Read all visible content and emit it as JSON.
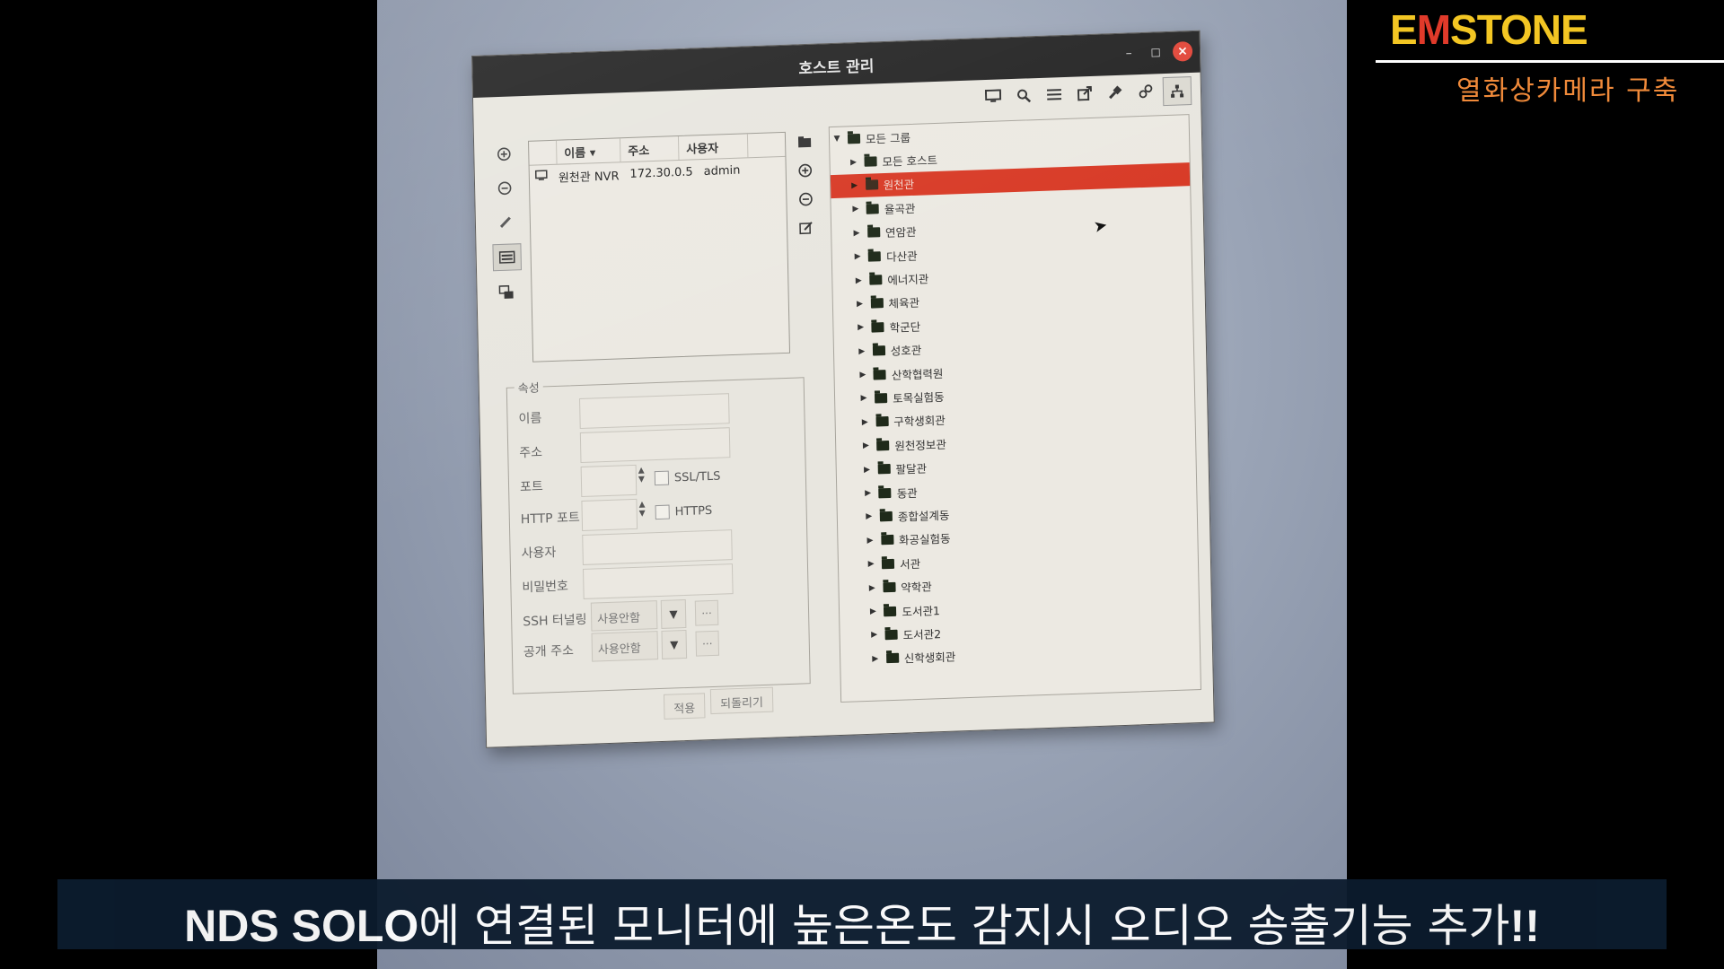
{
  "window": {
    "title": "호스트 관리",
    "min": "–",
    "max": "◻",
    "close": "×"
  },
  "toolbar_icons": [
    "monitor-icon",
    "search-icon",
    "list-icon",
    "external-link-icon",
    "plugin-icon",
    "unplug-icon",
    "hierarchy-icon"
  ],
  "host_table": {
    "columns": [
      "이름 ▾",
      "주소",
      "사용자"
    ],
    "rows": [
      {
        "name": "원천관 NVR",
        "address": "172.30.0.5",
        "user": "admin"
      }
    ]
  },
  "properties": {
    "legend": "속성",
    "name_label": "이름",
    "address_label": "주소",
    "port_label": "포트",
    "http_port_label": "HTTP 포트",
    "user_label": "사용자",
    "password_label": "비밀번호",
    "ssh_label": "SSH 터널링",
    "public_addr_label": "공개 주소",
    "ssl_label": "SSL/TLS",
    "https_label": "HTTPS",
    "ssh_value": "사용안함",
    "public_addr_value": "사용안함",
    "dots": "...",
    "apply": "적용",
    "revert": "되돌리기"
  },
  "tree": {
    "root": "모든 그룹",
    "items": [
      "모든 호스트",
      "원천관",
      "율곡관",
      "연암관",
      "다산관",
      "에너지관",
      "체육관",
      "학군단",
      "성호관",
      "산학협력원",
      "토목실험동",
      "구학생회관",
      "원천정보관",
      "팔달관",
      "동관",
      "종합설계동",
      "화공실험동",
      "서관",
      "약학관",
      "도서관1",
      "도서관2",
      "신학생회관"
    ],
    "selected_index": 1
  },
  "brand": {
    "e": "E",
    "m": "M",
    "stone": "STONE",
    "subtitle": "열화상카메라 구축"
  },
  "caption": {
    "bold": "NDS SOLO",
    "text": "에 연결된 모니터에 높은온도 감지시 오디오 송출기능 추가",
    "emph": "!!"
  }
}
